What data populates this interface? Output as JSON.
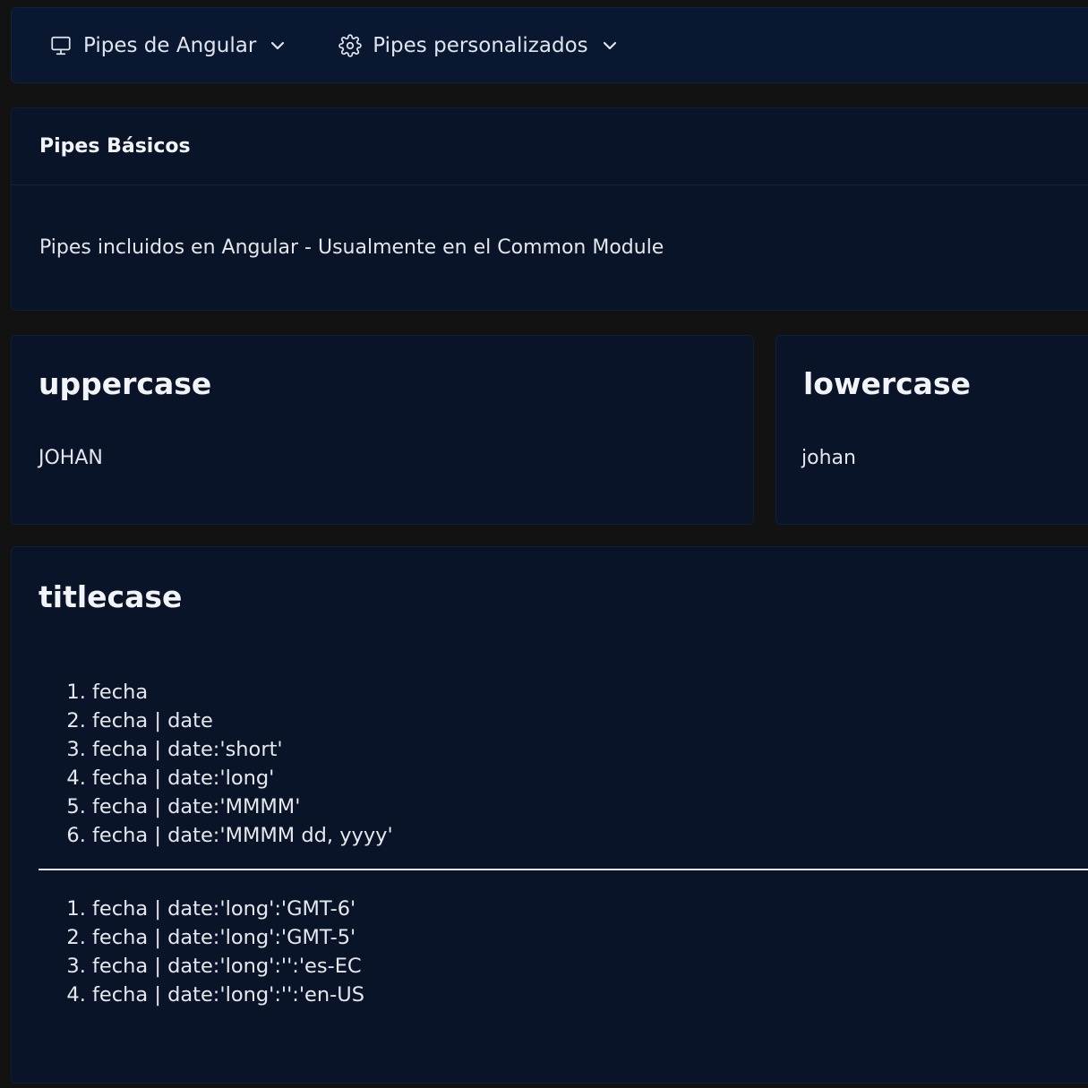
{
  "nav": {
    "items": [
      {
        "label": "Pipes de Angular",
        "icon": "monitor-icon"
      },
      {
        "label": "Pipes personalizados",
        "icon": "gear-icon"
      }
    ]
  },
  "basics_panel": {
    "header": "Pipes Básicos",
    "description": "Pipes incluidos en Angular - Usualmente en el Common Module"
  },
  "uppercase_card": {
    "title": "uppercase",
    "value": "JOHAN"
  },
  "lowercase_card": {
    "title": "lowercase",
    "value": "johan"
  },
  "titlecase_card": {
    "title": "titlecase",
    "list_a": [
      "fecha",
      "fecha | date",
      "fecha | date:'short'",
      "fecha | date:'long'",
      "fecha | date:'MMMM'",
      "fecha | date:'MMMM dd, yyyy'"
    ],
    "list_b": [
      "fecha | date:'long':'GMT-6'",
      "fecha | date:'long':'GMT-5'",
      "fecha | date:'long':'':'es-EC",
      "fecha | date:'long':'':'en-US"
    ]
  }
}
